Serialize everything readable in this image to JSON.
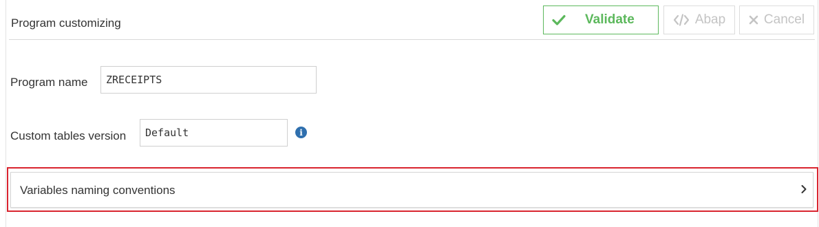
{
  "header": {
    "title": "Program customizing",
    "validate_label": "Validate",
    "abap_label": "Abap",
    "cancel_label": "Cancel"
  },
  "form": {
    "program_name_label": "Program name",
    "program_name_value": "ZRECEIPTS",
    "custom_tables_label": "Custom tables version",
    "custom_tables_value": "Default"
  },
  "panel": {
    "title": "Variables naming conventions"
  },
  "colors": {
    "validate_green": "#5cb85c",
    "highlight_red": "#d9232e",
    "info_blue": "#2f6fae",
    "disabled_gray": "#c4c4c4"
  }
}
